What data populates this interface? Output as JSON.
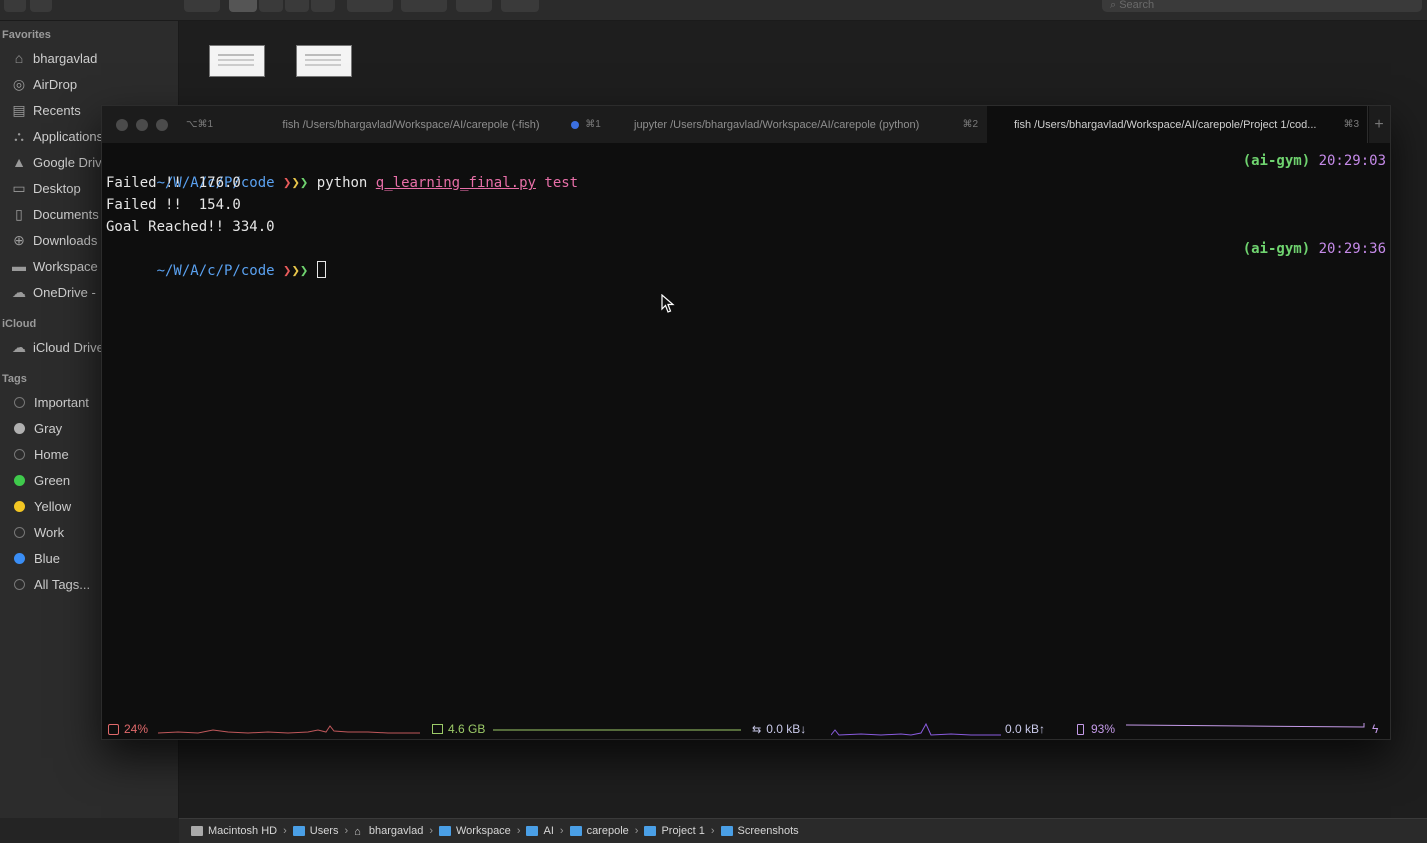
{
  "finder": {
    "toolbar": {
      "search_placeholder": "Search"
    },
    "sidebar": {
      "favorites_header": "Favorites",
      "favorites": [
        {
          "label": "bhargavlad",
          "icon": "house-icon"
        },
        {
          "label": "AirDrop",
          "icon": "airdrop-icon"
        },
        {
          "label": "Recents",
          "icon": "recents-icon"
        },
        {
          "label": "Applications",
          "icon": "applications-icon"
        },
        {
          "label": "Google Drive",
          "icon": "google-drive-icon"
        },
        {
          "label": "Desktop",
          "icon": "desktop-icon"
        },
        {
          "label": "Documents",
          "icon": "documents-icon"
        },
        {
          "label": "Downloads",
          "icon": "downloads-icon"
        },
        {
          "label": "Workspace",
          "icon": "folder-icon"
        },
        {
          "label": "OneDrive -",
          "icon": "cloud-icon"
        }
      ],
      "icloud_header": "iCloud",
      "icloud": [
        {
          "label": "iCloud Drive",
          "icon": "icloud-icon"
        }
      ],
      "tags_header": "Tags",
      "tags": [
        {
          "label": "Important",
          "color": "transparent"
        },
        {
          "label": "Gray",
          "color": "#b0b0b0"
        },
        {
          "label": "Home",
          "color": "transparent"
        },
        {
          "label": "Green",
          "color": "#3fca4c"
        },
        {
          "label": "Yellow",
          "color": "#f2c623"
        },
        {
          "label": "Work",
          "color": "transparent"
        },
        {
          "label": "Blue",
          "color": "#3a8ef6"
        },
        {
          "label": "All Tags...",
          "color": "transparent"
        }
      ]
    },
    "pathbar": [
      {
        "label": "Macintosh HD",
        "icon": "hard-drive-icon"
      },
      {
        "label": "Users",
        "icon": "folder-icon"
      },
      {
        "label": "bhargavlad",
        "icon": "home-icon"
      },
      {
        "label": "Workspace",
        "icon": "folder-icon"
      },
      {
        "label": "AI",
        "icon": "folder-icon"
      },
      {
        "label": "carepole",
        "icon": "folder-icon"
      },
      {
        "label": "Project 1",
        "icon": "folder-icon"
      },
      {
        "label": "Screenshots",
        "icon": "folder-icon"
      }
    ]
  },
  "terminal": {
    "titlebar_shortcut": "⌥⌘1",
    "tabs": [
      {
        "title": "fish /Users/bhargavlad/Workspace/AI/carepole (-fish)",
        "shortcut": "",
        "active": false
      },
      {
        "title": "jupyter /Users/bhargavlad/Workspace/AI/carepole (python)",
        "shortcut": "⌘2",
        "active": false
      },
      {
        "title": "fish /Users/bhargavlad/Workspace/AI/carepole/Project 1/cod...",
        "shortcut": "⌘3",
        "active": true
      }
    ],
    "tab1_dot_shortcut": "⌘1",
    "lines": {
      "prompt_path": "~/W/A/c/P/code",
      "arrows": "❯❯❯",
      "command": "python",
      "script": "q_learning_final.py",
      "argument": "test",
      "output1": "Failed !!  176.0",
      "output2": "Failed !!  154.0",
      "output3": "Goal Reached!! 334.0",
      "env": "(ai-gym)",
      "time1": "20:29:03",
      "time2": "20:29:36"
    },
    "status": {
      "cpu": "24%",
      "memory": "4.6 GB",
      "net_down": "0.0 kB↓",
      "net_up": "0.0 kB↑",
      "battery": "93%",
      "colors": {
        "cpu": "#e0696b",
        "memory": "#9ccb68",
        "network": "#8a5ce0",
        "battery": "#c49ae8",
        "net_text": "#c9c9e9"
      }
    }
  }
}
